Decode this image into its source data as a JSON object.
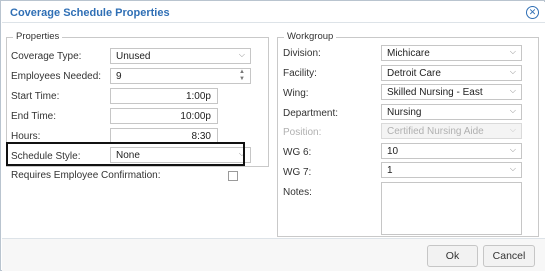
{
  "dialog": {
    "title": "Coverage Schedule Properties",
    "close_glyph": "✕"
  },
  "properties": {
    "legend": "Properties",
    "coverage_type": {
      "label": "Coverage Type:",
      "value": "Unused"
    },
    "employees_needed": {
      "label": "Employees Needed:",
      "value": "9"
    },
    "start_time": {
      "label": "Start Time:",
      "value": "1:00p"
    },
    "end_time": {
      "label": "End Time:",
      "value": "10:00p"
    },
    "hours": {
      "label": "Hours:",
      "value": "8:30"
    },
    "schedule_style": {
      "label": "Schedule Style:",
      "value": "None"
    },
    "requires_confirmation": {
      "label": "Requires Employee Confirmation:",
      "checked": false
    }
  },
  "workgroup": {
    "legend": "Workgroup",
    "division": {
      "label": "Division:",
      "value": "Michicare"
    },
    "facility": {
      "label": "Facility:",
      "value": "Detroit Care"
    },
    "wing": {
      "label": "Wing:",
      "value": "Skilled Nursing - East"
    },
    "department": {
      "label": "Department:",
      "value": "Nursing"
    },
    "position": {
      "label": "Position:",
      "value": "Certified Nursing Aide",
      "disabled": true
    },
    "wg6": {
      "label": "WG 6:",
      "value": "10"
    },
    "wg7": {
      "label": "WG 7:",
      "value": "1"
    },
    "notes": {
      "label": "Notes:",
      "value": ""
    }
  },
  "footer": {
    "ok_label": "Ok",
    "cancel_label": "Cancel"
  },
  "icons": {
    "dropdown": "chevron-down-icon",
    "spinner": "spinner-icon",
    "close": "close-icon"
  },
  "colors": {
    "title": "#2f6fb5",
    "border": "#c9c9c9",
    "disabled_text": "#b0b0b0",
    "highlight_outline": "#111111"
  }
}
